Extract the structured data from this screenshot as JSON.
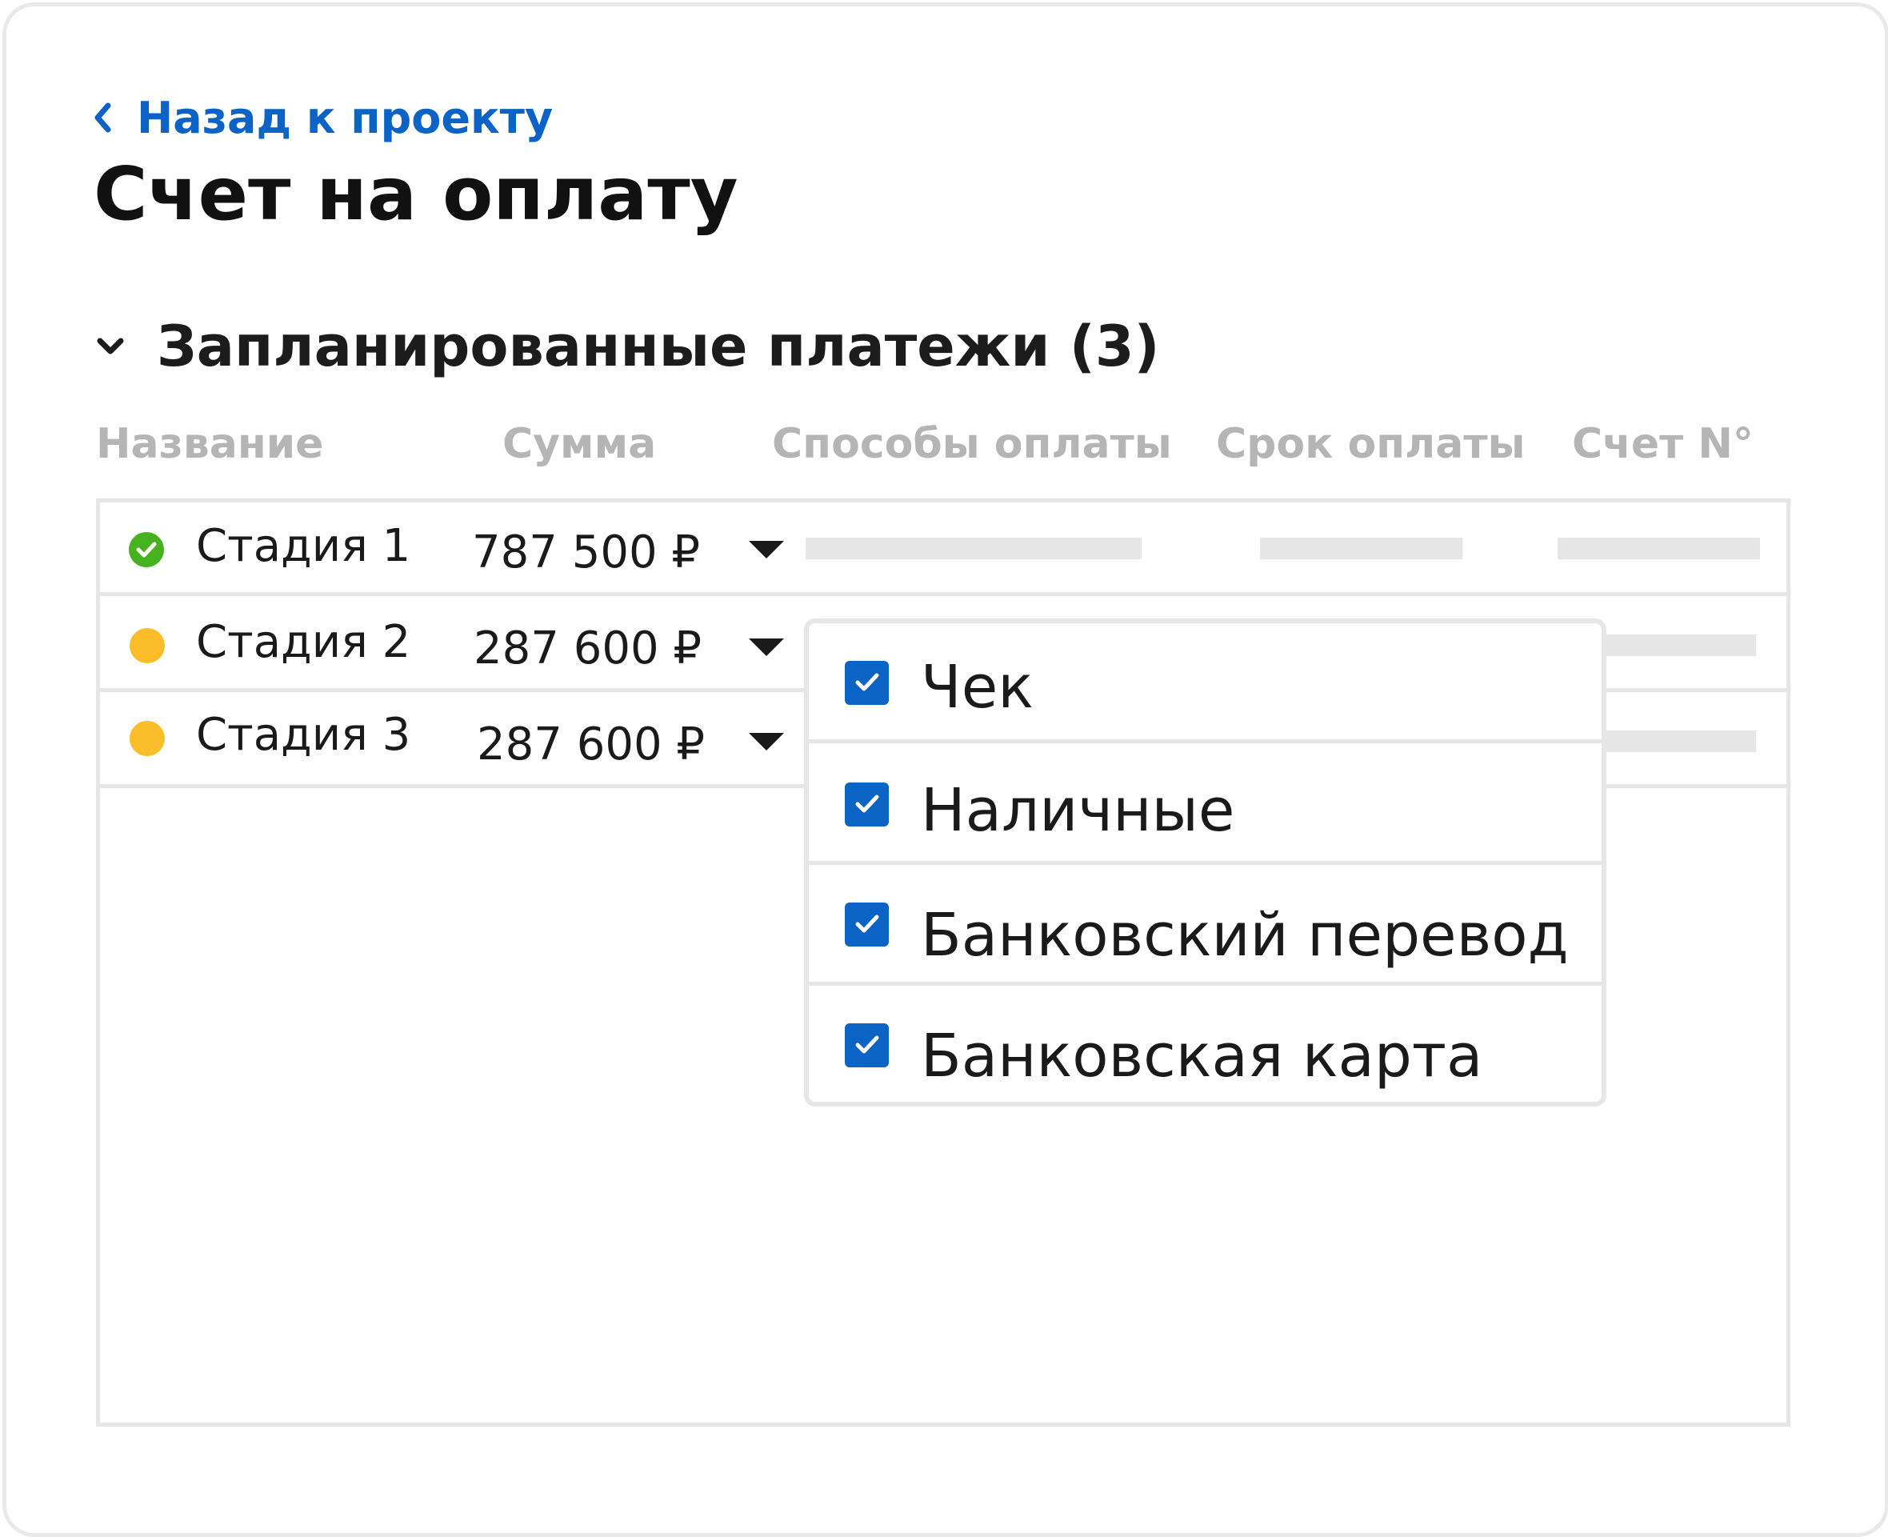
{
  "nav": {
    "back_label": "Назад к проекту"
  },
  "page": {
    "title": "Счет на оплату"
  },
  "section": {
    "title": "Запланированные платежи (3)"
  },
  "table": {
    "columns": [
      "Название",
      "Сумма",
      "Способы оплаты",
      "Срок оплаты",
      "Счет N°"
    ],
    "rows": [
      {
        "name": "Стадия 1",
        "amount": "787 500 ₽",
        "status": "completed"
      },
      {
        "name": "Стадия 2",
        "amount": "287 600 ₽",
        "status": "pending"
      },
      {
        "name": "Стадия 3",
        "amount": "287 600 ₽",
        "status": "pending"
      }
    ]
  },
  "payment_methods_dropdown": {
    "options": [
      {
        "label": "Чек",
        "checked": true
      },
      {
        "label": "Наличные",
        "checked": true
      },
      {
        "label": "Банковский перевод",
        "checked": true
      },
      {
        "label": "Банковская карта",
        "checked": true
      }
    ]
  },
  "colors": {
    "accent": "#0b63c5",
    "status_completed": "#47b21f",
    "status_pending": "#fcbd2b",
    "border": "#e6e6e6",
    "muted_text": "#b5b5b5"
  },
  "icons": {
    "back": "chevron-left-icon",
    "section_toggle": "chevron-down-icon",
    "status_completed": "check-circle-icon",
    "status_pending": "dot-icon",
    "row_dropdown": "caret-down-icon",
    "option_checked": "checkbox-checked-icon"
  }
}
